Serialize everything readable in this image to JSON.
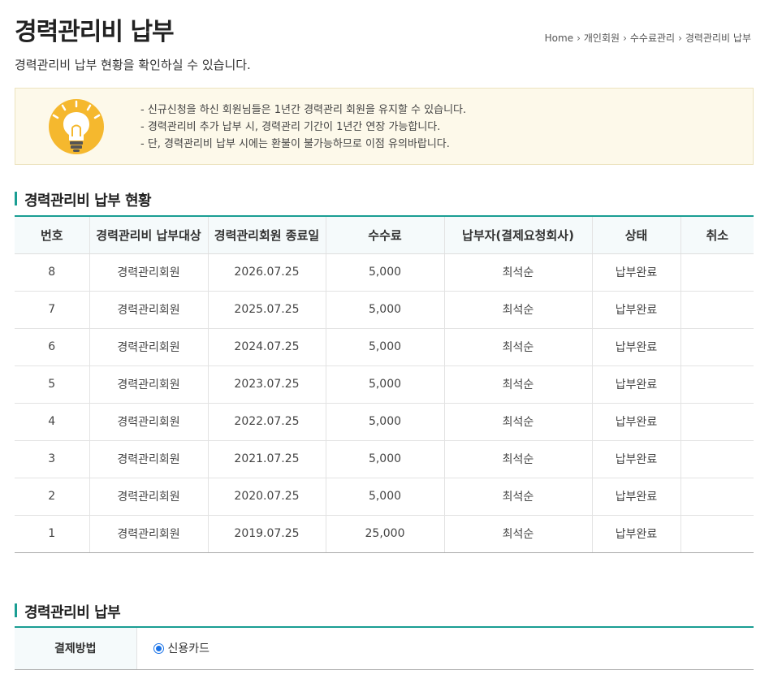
{
  "page": {
    "title": "경력관리비 납부",
    "description": "경력관리비 납부 현황을 확인하실 수 있습니다."
  },
  "breadcrumb": {
    "items": [
      "Home",
      "개인회원",
      "수수료관리",
      "경력관리비 납부"
    ],
    "separator": "›"
  },
  "notice": {
    "icon": "lightbulb-icon",
    "lines": [
      "- 신규신청을 하신 회원님들은 1년간 경력관리 회원을 유지할 수 있습니다.",
      "- 경력관리비 추가 납부 시, 경력관리 기간이 1년간 연장 가능합니다.",
      "- 단, 경력관리비 납부 시에는 환불이 불가능하므로 이점 유의바랍니다."
    ]
  },
  "history": {
    "title": "경력관리비 납부 현황",
    "columns": [
      "번호",
      "경력관리비 납부대상",
      "경력관리회원 종료일",
      "수수료",
      "납부자(결제요청회사)",
      "상태",
      "취소"
    ],
    "rows": [
      [
        "8",
        "경력관리회원",
        "2026.07.25",
        "5,000",
        "최석순",
        "납부완료",
        ""
      ],
      [
        "7",
        "경력관리회원",
        "2025.07.25",
        "5,000",
        "최석순",
        "납부완료",
        ""
      ],
      [
        "6",
        "경력관리회원",
        "2024.07.25",
        "5,000",
        "최석순",
        "납부완료",
        ""
      ],
      [
        "5",
        "경력관리회원",
        "2023.07.25",
        "5,000",
        "최석순",
        "납부완료",
        ""
      ],
      [
        "4",
        "경력관리회원",
        "2022.07.25",
        "5,000",
        "최석순",
        "납부완료",
        ""
      ],
      [
        "3",
        "경력관리회원",
        "2021.07.25",
        "5,000",
        "최석순",
        "납부완료",
        ""
      ],
      [
        "2",
        "경력관리회원",
        "2020.07.25",
        "5,000",
        "최석순",
        "납부완료",
        ""
      ],
      [
        "1",
        "경력관리회원",
        "2019.07.25",
        "25,000",
        "최석순",
        "납부완료",
        ""
      ]
    ]
  },
  "payment": {
    "title": "경력관리비 납부",
    "method_label": "결제방법",
    "options": [
      "신용카드"
    ],
    "selected": "신용카드"
  },
  "colors": {
    "accent": "#1a9e93",
    "notice_bg": "#fdf9ea",
    "bulb": "#f5b82e",
    "radio": "#1a73e8"
  }
}
